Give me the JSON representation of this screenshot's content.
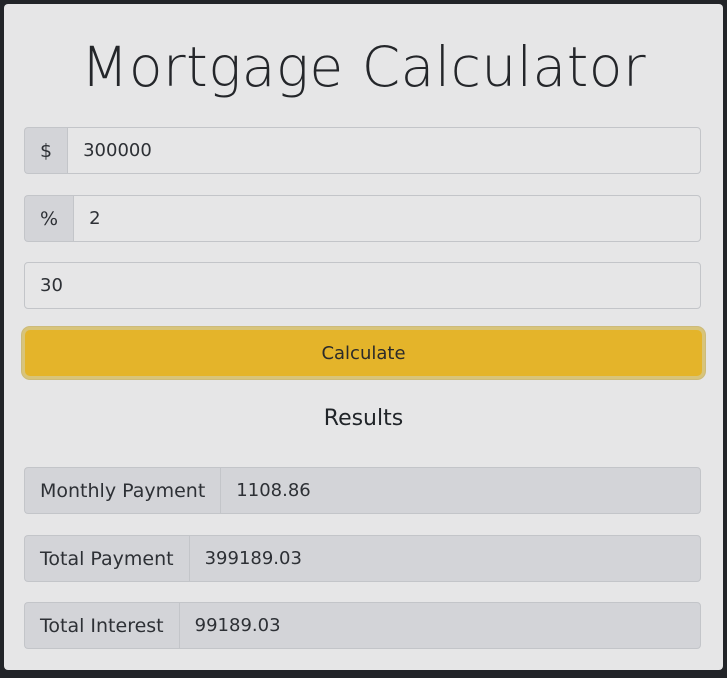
{
  "title": "Mortgage Calculator",
  "inputs": {
    "principal": {
      "addon": "$",
      "value": "300000"
    },
    "rate": {
      "addon": "%",
      "value": "2"
    },
    "term": {
      "value": "30"
    }
  },
  "calculate_label": "Calculate",
  "results": {
    "heading": "Results",
    "rows": [
      {
        "label": "Monthly Payment",
        "value": "1108.86"
      },
      {
        "label": "Total Payment",
        "value": "399189.03"
      },
      {
        "label": "Total Interest",
        "value": "99189.03"
      }
    ]
  },
  "colors": {
    "accent": "#e4b42a",
    "background": "#e6e6e7",
    "addon": "#d3d4d8"
  }
}
